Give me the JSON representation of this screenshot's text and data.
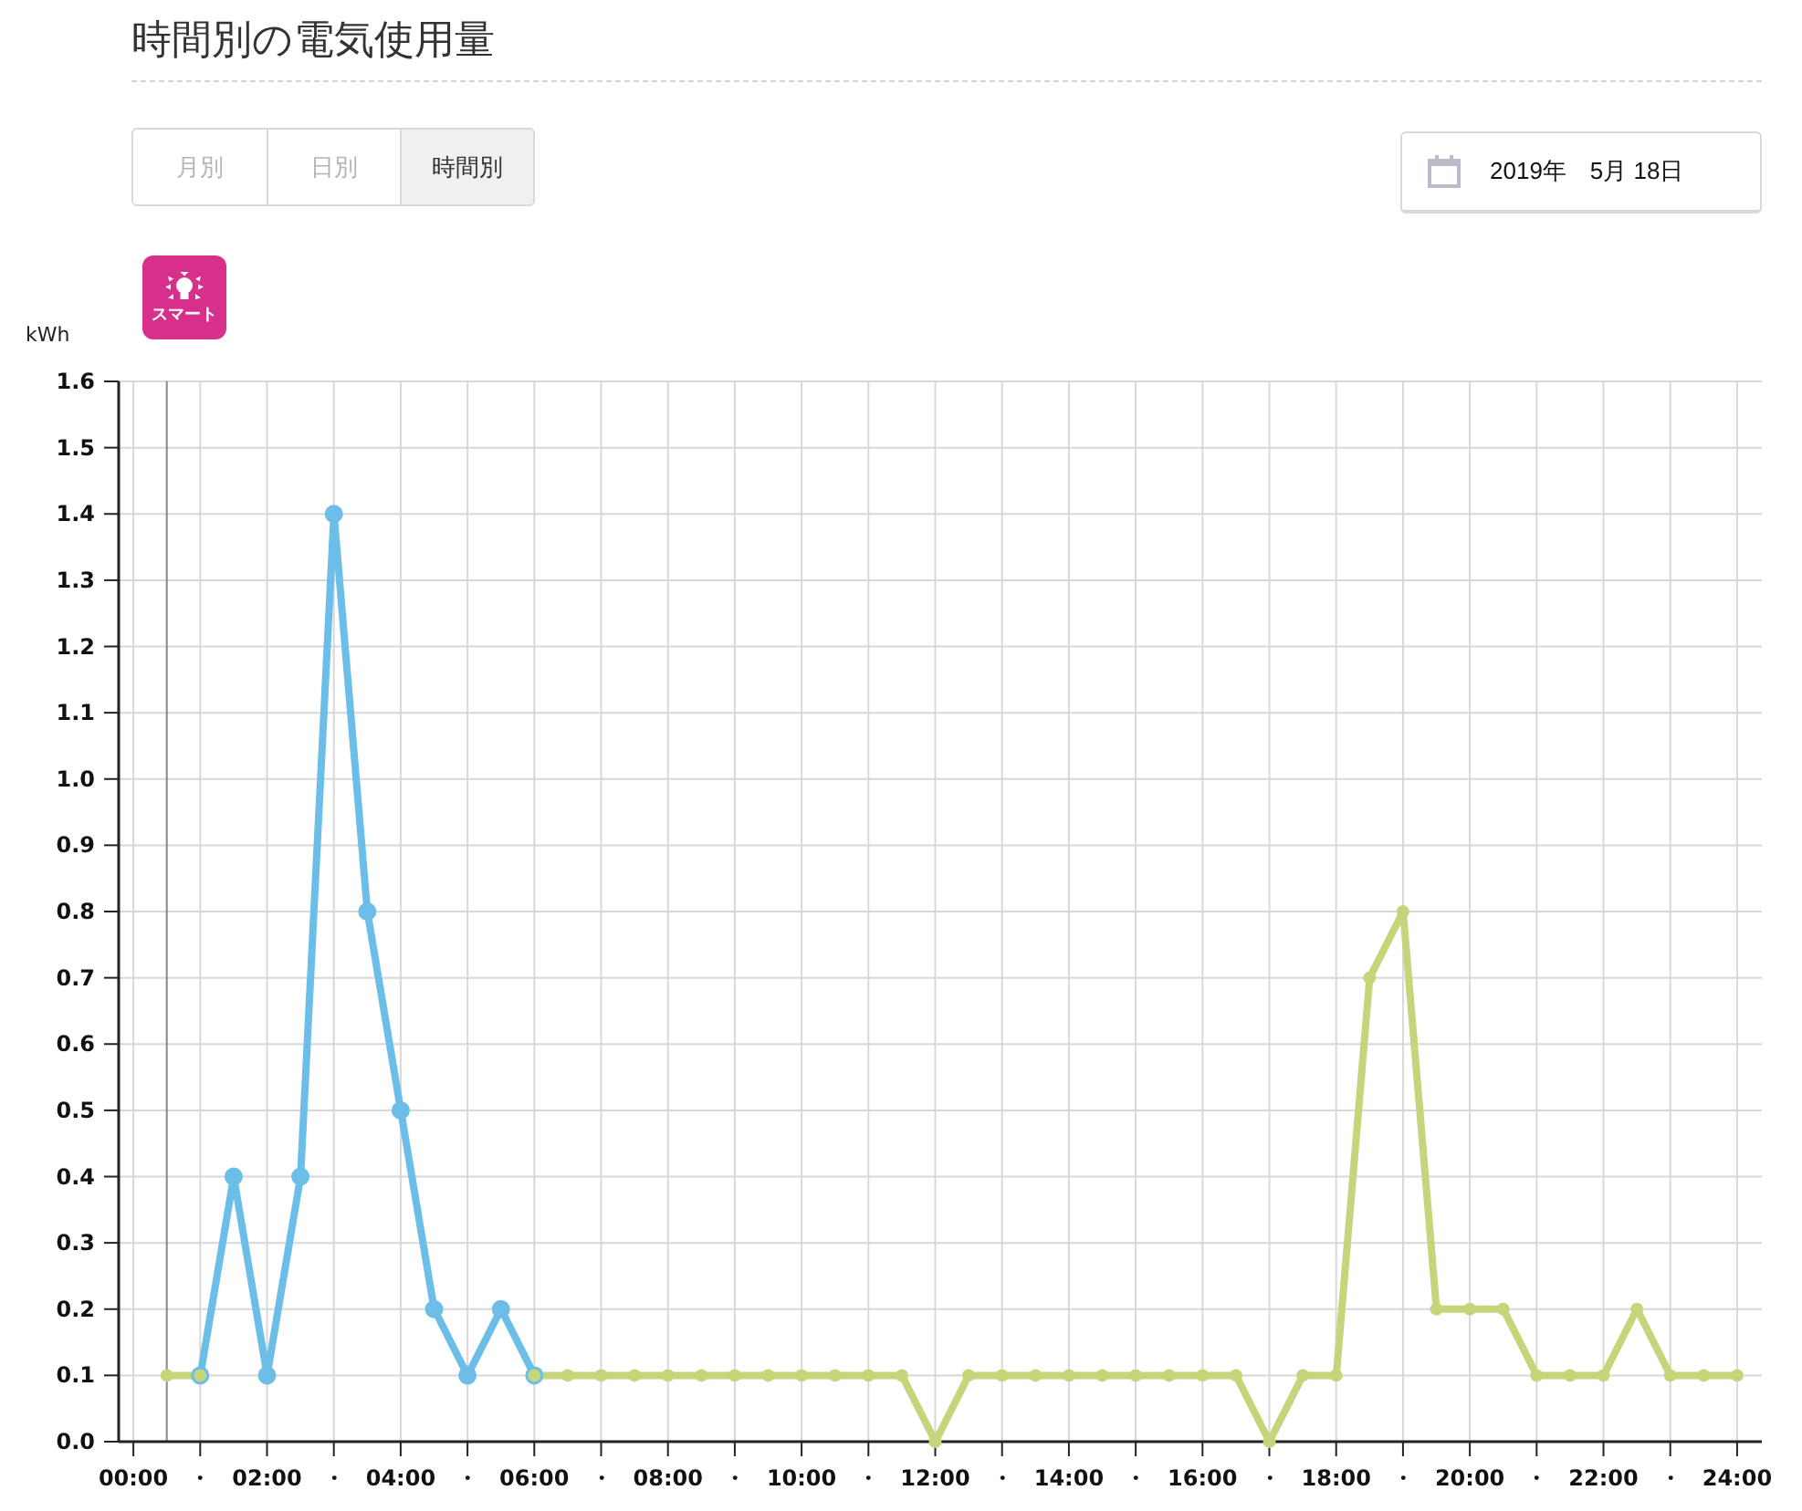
{
  "page": {
    "title": "時間別の電気使用量"
  },
  "tabs": [
    {
      "label": "月別",
      "selected": false
    },
    {
      "label": "日別",
      "selected": false
    },
    {
      "label": "時間別",
      "selected": true
    }
  ],
  "date_picker": {
    "value": "2019年　5月 18日"
  },
  "plan_badge": {
    "label": "スマート"
  },
  "chart_data": {
    "type": "line",
    "ylabel": "kWh",
    "x": [
      0.5,
      1,
      1.5,
      2,
      2.5,
      3,
      3.5,
      4,
      4.5,
      5,
      5.5,
      6,
      6.5,
      7,
      7.5,
      8,
      8.5,
      9,
      9.5,
      10,
      10.5,
      11,
      11.5,
      12,
      12.5,
      13,
      13.5,
      14,
      14.5,
      15,
      15.5,
      16,
      16.5,
      17,
      17.5,
      18,
      18.5,
      19,
      19.5,
      20,
      20.5,
      21,
      21.5,
      22,
      22.5,
      23,
      23.5,
      24
    ],
    "grid": true,
    "ref_lines": [
      {
        "axis": "x",
        "value": 0.5
      }
    ],
    "series": [
      {
        "color": "#6cbde8",
        "marker": "circle",
        "values": [
          null,
          0.1,
          0.4,
          0.1,
          0.4,
          1.4,
          0.8,
          0.5,
          0.2,
          0.1,
          0.2,
          0.1,
          null,
          null,
          null,
          null,
          null,
          null,
          null,
          null,
          null,
          null,
          null,
          null,
          null,
          null,
          null,
          null,
          null,
          null,
          null,
          null,
          null,
          null,
          null,
          null,
          null,
          null,
          null,
          null,
          null,
          null,
          null,
          null,
          null,
          null,
          null,
          null
        ]
      },
      {
        "color": "#c5d67a",
        "marker": "circle",
        "values": [
          0.1,
          0.1,
          null,
          null,
          null,
          null,
          null,
          null,
          null,
          null,
          null,
          0.1,
          0.1,
          0.1,
          0.1,
          0.1,
          0.1,
          0.1,
          0.1,
          0.1,
          0.1,
          0.1,
          0.1,
          0.0,
          0.1,
          0.1,
          0.1,
          0.1,
          0.1,
          0.1,
          0.1,
          0.1,
          0.1,
          0.0,
          0.1,
          0.1,
          0.7,
          0.8,
          0.2,
          0.2,
          0.2,
          0.1,
          0.1,
          0.1,
          0.2,
          0.1,
          0.1,
          0.1
        ]
      }
    ],
    "xlim": [
      -0.22,
      24.37
    ],
    "ylim": [
      0,
      1.6
    ],
    "xticks": [
      {
        "value": 0,
        "label": "00:00"
      },
      {
        "value": 1,
        "label": "・"
      },
      {
        "value": 2,
        "label": "02:00"
      },
      {
        "value": 3,
        "label": "・"
      },
      {
        "value": 4,
        "label": "04:00"
      },
      {
        "value": 5,
        "label": "・"
      },
      {
        "value": 6,
        "label": "06:00"
      },
      {
        "value": 7,
        "label": "・"
      },
      {
        "value": 8,
        "label": "08:00"
      },
      {
        "value": 9,
        "label": "・"
      },
      {
        "value": 10,
        "label": "10:00"
      },
      {
        "value": 11,
        "label": "・"
      },
      {
        "value": 12,
        "label": "12:00"
      },
      {
        "value": 13,
        "label": "・"
      },
      {
        "value": 14,
        "label": "14:00"
      },
      {
        "value": 15,
        "label": "・"
      },
      {
        "value": 16,
        "label": "16:00"
      },
      {
        "value": 17,
        "label": "・"
      },
      {
        "value": 18,
        "label": "18:00"
      },
      {
        "value": 19,
        "label": "・"
      },
      {
        "value": 20,
        "label": "20:00"
      },
      {
        "value": 21,
        "label": "・"
      },
      {
        "value": 22,
        "label": "22:00"
      },
      {
        "value": 23,
        "label": "・"
      },
      {
        "value": 24,
        "label": "24:00"
      }
    ],
    "yticks": [
      {
        "value": 0,
        "label": "0.0"
      },
      {
        "value": 0.1,
        "label": "0.1"
      },
      {
        "value": 0.2,
        "label": "0.2"
      },
      {
        "value": 0.3,
        "label": "0.3"
      },
      {
        "value": 0.4,
        "label": "0.4"
      },
      {
        "value": 0.5,
        "label": "0.5"
      },
      {
        "value": 0.6,
        "label": "0.6"
      },
      {
        "value": 0.7,
        "label": "0.7"
      },
      {
        "value": 0.8,
        "label": "0.8"
      },
      {
        "value": 0.9,
        "label": "0.9"
      },
      {
        "value": 1.0,
        "label": "1.0"
      },
      {
        "value": 1.1,
        "label": "1.1"
      },
      {
        "value": 1.2,
        "label": "1.2"
      },
      {
        "value": 1.3,
        "label": "1.3"
      },
      {
        "value": 1.4,
        "label": "1.4"
      },
      {
        "value": 1.5,
        "label": "1.5"
      },
      {
        "value": 1.6,
        "label": "1.6"
      }
    ]
  }
}
